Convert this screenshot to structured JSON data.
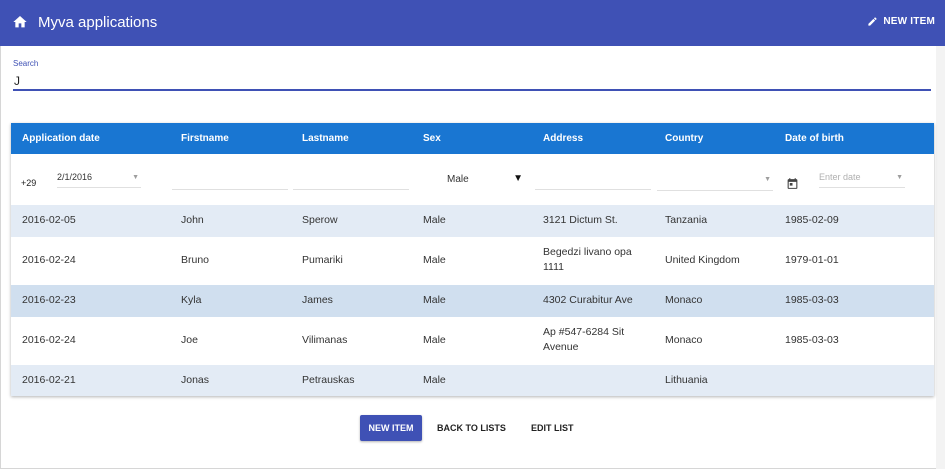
{
  "appbar": {
    "title": "Myva applications",
    "home_icon": "home-icon",
    "new_item_label": "NEW ITEM",
    "new_item_icon": "pencil-icon",
    "color": "#3f51b5"
  },
  "search": {
    "label": "Search",
    "value": "J"
  },
  "table": {
    "header_color": "#1976d2",
    "columns": [
      "Application date",
      "Firstname",
      "Lastname",
      "Sex",
      "Address",
      "Country",
      "Date of birth"
    ],
    "filters": {
      "count": "+29",
      "application_date": "2/1/2016",
      "firstname": "",
      "lastname": "",
      "sex": "Male",
      "address": "",
      "country": "",
      "date_of_birth_placeholder": "Enter date"
    },
    "rows": [
      {
        "date": "2016-02-05",
        "first": "John",
        "last": "Sperow",
        "sex": "Male",
        "address": "3121 Dictum St.",
        "country": "Tanzania",
        "birth": "1985-02-09"
      },
      {
        "date": "2016-02-24",
        "first": "Bruno",
        "last": "Pumariki",
        "sex": "Male",
        "address": "Begedzi livano opa 1111",
        "country": "United Kingdom",
        "birth": "1979-01-01"
      },
      {
        "date": "2016-02-23",
        "first": "Kyla",
        "last": "James",
        "sex": "Male",
        "address": "4302 Curabitur Ave",
        "country": "Monaco",
        "birth": "1985-03-03"
      },
      {
        "date": "2016-02-24",
        "first": "Joe",
        "last": "Vilimanas",
        "sex": "Male",
        "address": "Ap #547-6284 Sit Avenue",
        "country": "Monaco",
        "birth": "1985-03-03"
      },
      {
        "date": "2016-02-21",
        "first": "Jonas",
        "last": "Petrauskas",
        "sex": "Male",
        "address": "",
        "country": "Lithuania",
        "birth": ""
      }
    ]
  },
  "actions": {
    "new_item": "NEW ITEM",
    "back_to_lists": "BACK TO LISTS",
    "edit_list": "EDIT LIST"
  }
}
